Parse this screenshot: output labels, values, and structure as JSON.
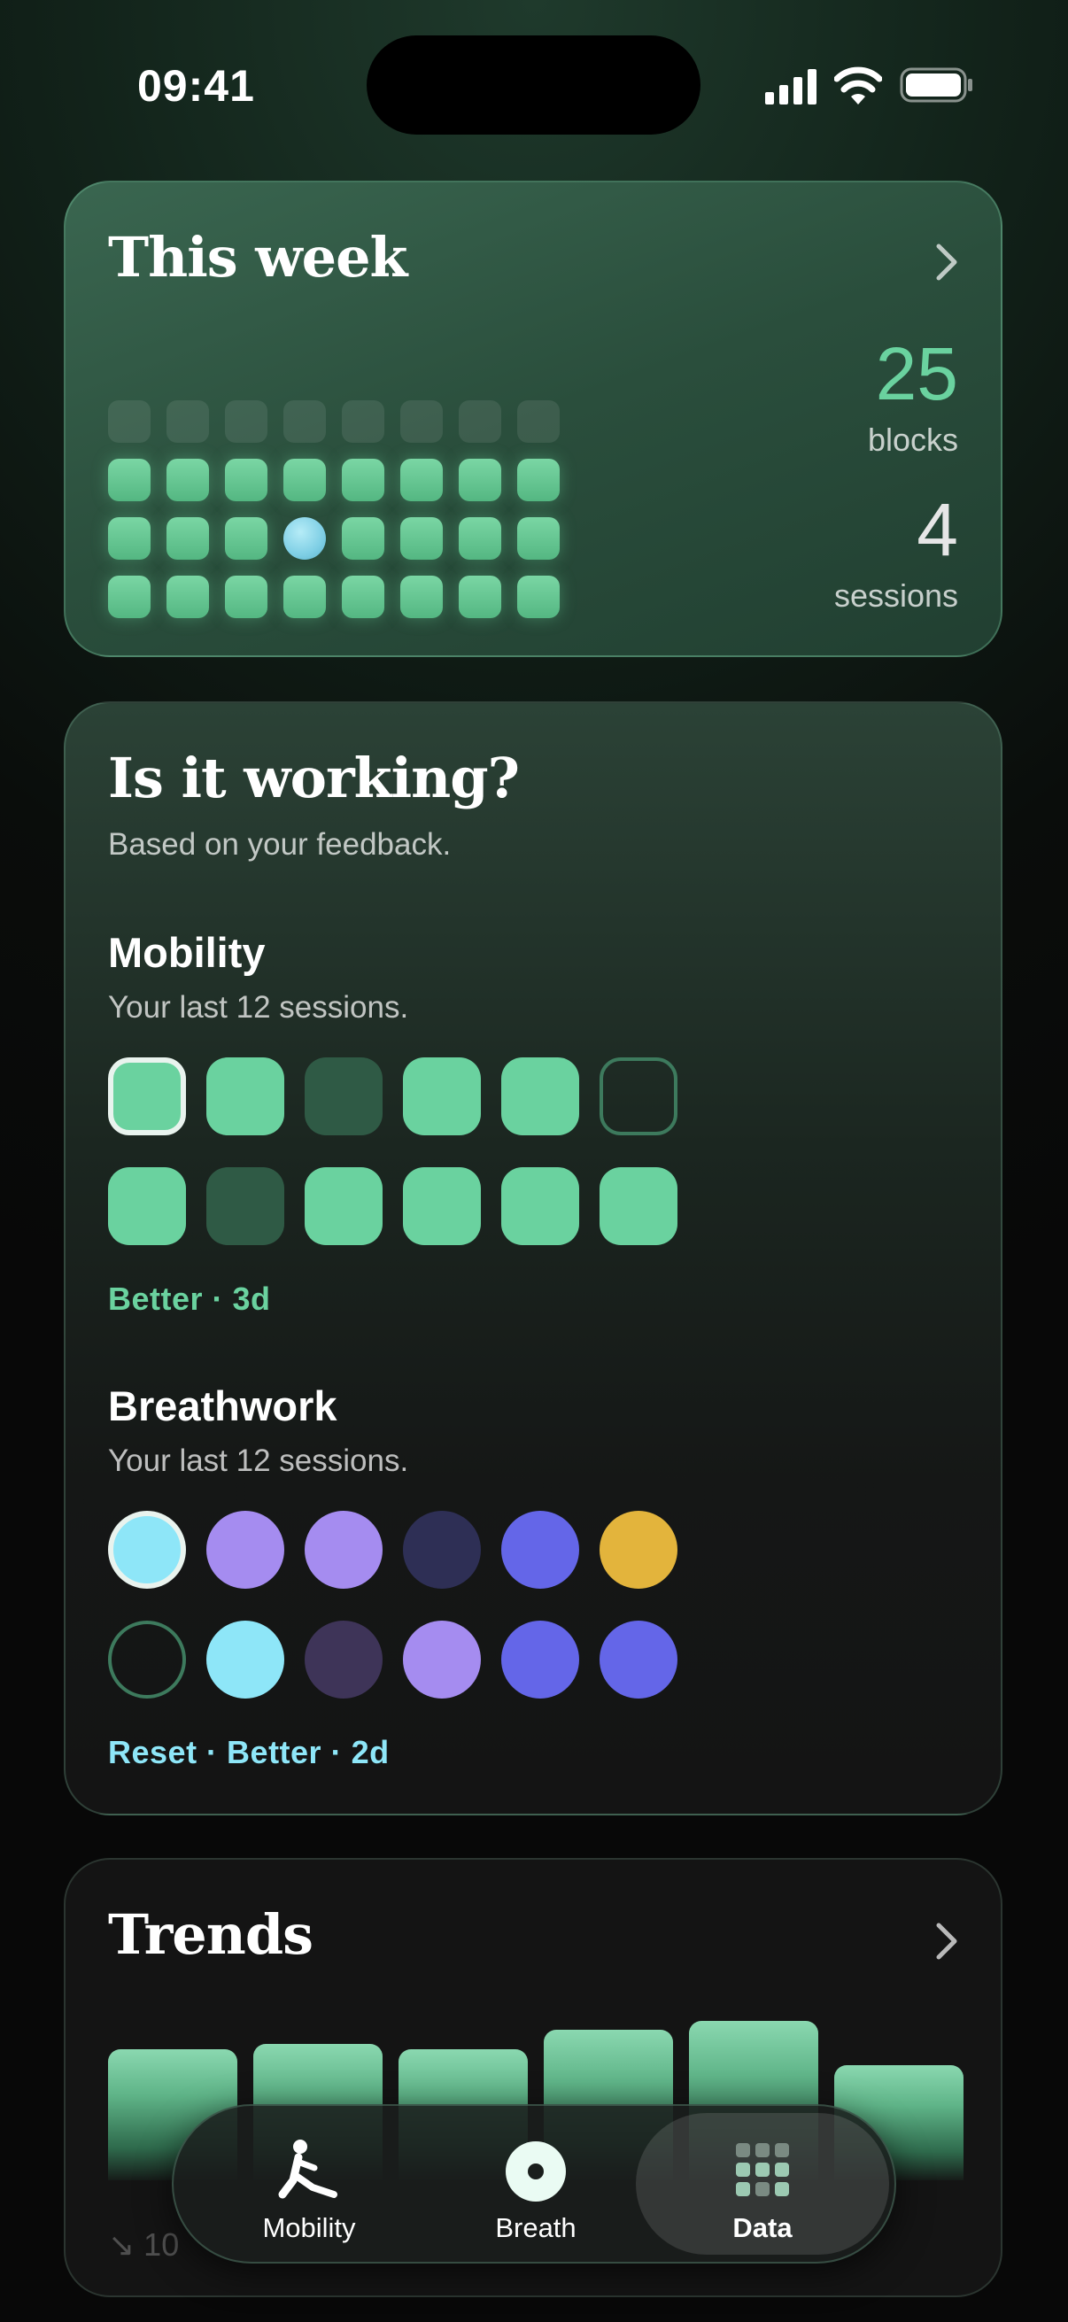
{
  "status": {
    "time": "09:41"
  },
  "week": {
    "title": "This week",
    "blocks_value": "25",
    "blocks_label": "blocks",
    "sessions_value": "4",
    "sessions_label": "sessions"
  },
  "working": {
    "title": "Is it working?",
    "subtitle": "Based on your feedback.",
    "mobility": {
      "title": "Mobility",
      "subtitle": "Your last 12 sessions.",
      "result": "Better · 3d"
    },
    "breathwork": {
      "title": "Breathwork",
      "subtitle": "Your last 12 sessions.",
      "result": "Reset · Better · 2d"
    }
  },
  "trends": {
    "title": "Trends",
    "footer_text": "↘ 10"
  },
  "tabs": [
    {
      "label": "Mobility",
      "icon": "stretch-person-icon"
    },
    {
      "label": "Breath",
      "icon": "breath-circle-icon"
    },
    {
      "label": "Data",
      "icon": "dot-grid-icon"
    }
  ],
  "colors": {
    "accent_green": "#6ad29f",
    "accent_cyan": "#8ee6f8",
    "lavender": "#a58cf0",
    "indigo": "#6466e8",
    "gold": "#e3b43c"
  }
}
